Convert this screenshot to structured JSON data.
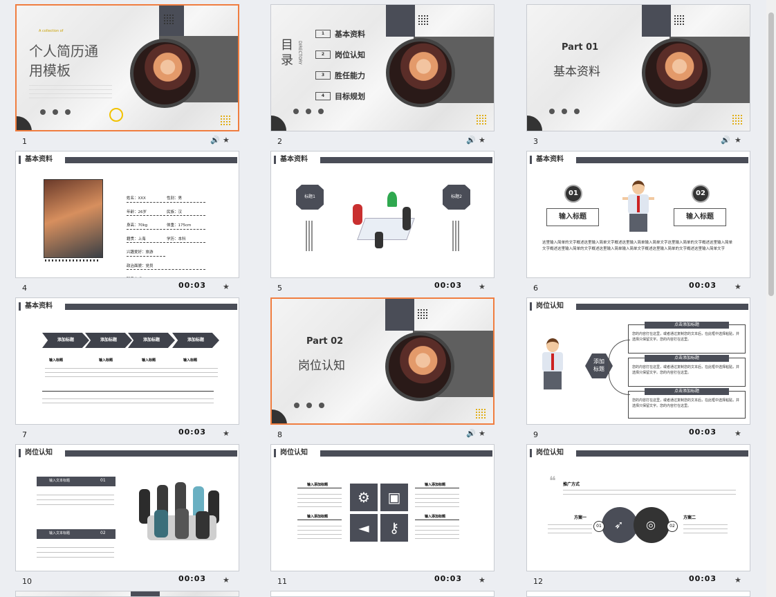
{
  "slides": [
    {
      "num": "1",
      "title_line1": "个人简历通",
      "title_line2": "用模板",
      "tagline": "A collection of"
    },
    {
      "num": "2",
      "toc_title": "目录",
      "toc_sub": "DIRECTORY",
      "items": [
        {
          "n": "1",
          "label": "基本资料"
        },
        {
          "n": "2",
          "label": "岗位认知"
        },
        {
          "n": "3",
          "label": "胜任能力"
        },
        {
          "n": "4",
          "label": "目标规划"
        }
      ]
    },
    {
      "num": "3",
      "part": "Part 01",
      "part_title": "基本资料"
    },
    {
      "num": "4",
      "header": "基本资料",
      "time": "00:03",
      "fields": [
        "姓名：XXX",
        "性别：男",
        "年龄：26岁",
        "民族：汉",
        "身高：70kg",
        "体重：175cm",
        "籍贯：上海",
        "学历：本科",
        "兴趣爱好：旅游",
        "政治面貌：党员",
        "联系方式：12365xxxxxx",
        "电子邮箱：11111110qq.com",
        "现住地址：xxxxxxxx"
      ]
    },
    {
      "num": "5",
      "header": "基本资料",
      "time": "00:03",
      "tag1": "标题1",
      "tag2": "标题2"
    },
    {
      "num": "6",
      "header": "基本资料",
      "time": "00:03",
      "b1": "01",
      "b2": "02",
      "t1": "输入标题",
      "t2": "输入标题",
      "body": "这里输入简单的文字概述这里输入简单文字概述这里输入简单输入简单文字这里输入简单的文字概述这里输入简单文字概述这里输入简单的文字概述这里输入简单输入简单文字概述这里输入简单的文字概述这里输入简单文字"
    },
    {
      "num": "7",
      "header": "基本资料",
      "time": "00:03",
      "chevs": [
        "添加标题",
        "添加标题",
        "添加标题",
        "添加标题"
      ],
      "cols": [
        "输入标题",
        "输入标题",
        "输入标题",
        "输入标题"
      ]
    },
    {
      "num": "8",
      "part": "Part 02",
      "part_title": "岗位认知"
    },
    {
      "num": "9",
      "header": "岗位认知",
      "time": "00:03",
      "center": "添加\n标题",
      "items": [
        "点击添加标题",
        "点击添加标题",
        "点击添加标题"
      ],
      "desc": "您的内容打在这里，或者通过复制您的文本后，在此框中选择粘贴，并选择只保留文字。您的内容打在这里。"
    },
    {
      "num": "10",
      "header": "岗位认知",
      "time": "00:03",
      "r1": "输入文本标题",
      "r1n": "01",
      "r2": "输入文本标题",
      "r2n": "02"
    },
    {
      "num": "11",
      "header": "岗位认知",
      "time": "00:03",
      "l1": "输入添加标题",
      "l2": "输入添加标题",
      "r1": "输入添加标题",
      "r2": "输入添加标题"
    },
    {
      "num": "12",
      "header": "岗位认知",
      "time": "00:03",
      "lead": "推广方式",
      "p1": "方案一",
      "p2": "方案二",
      "n1": "01",
      "n2": "02"
    }
  ]
}
